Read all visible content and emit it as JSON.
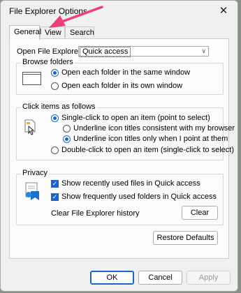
{
  "window": {
    "title": "File Explorer Options",
    "close_glyph": "✕"
  },
  "tabs": [
    {
      "label": "General",
      "active": true
    },
    {
      "label": "View",
      "active": false
    },
    {
      "label": "Search",
      "active": false
    }
  ],
  "general": {
    "open_to_label": "Open File Explorer to:",
    "open_to_value": "Quick access",
    "browse_folders": {
      "title": "Browse folders",
      "options": [
        {
          "label": "Open each folder in the same window",
          "selected": true
        },
        {
          "label": "Open each folder in its own window",
          "selected": false
        }
      ]
    },
    "click_items": {
      "title": "Click items as follows",
      "single_click": {
        "label": "Single-click to open an item (point to select)",
        "selected": true
      },
      "underline_browser": {
        "label": "Underline icon titles consistent with my browser",
        "selected": false
      },
      "underline_point": {
        "label": "Underline icon titles only when I point at them",
        "selected": true
      },
      "double_click": {
        "label": "Double-click to open an item (single-click to select)",
        "selected": false
      }
    },
    "privacy": {
      "title": "Privacy",
      "recent_files": {
        "label": "Show recently used files in Quick access",
        "checked": true
      },
      "frequent_folders": {
        "label": "Show frequently used folders in Quick access",
        "checked": true
      },
      "clear_label": "Clear File Explorer history",
      "clear_button": "Clear"
    },
    "restore_button": "Restore Defaults"
  },
  "footer": {
    "ok": "OK",
    "cancel": "Cancel",
    "apply": "Apply"
  },
  "colors": {
    "accent": "#1a66c5",
    "annotation_arrow": "#ee3f78"
  }
}
